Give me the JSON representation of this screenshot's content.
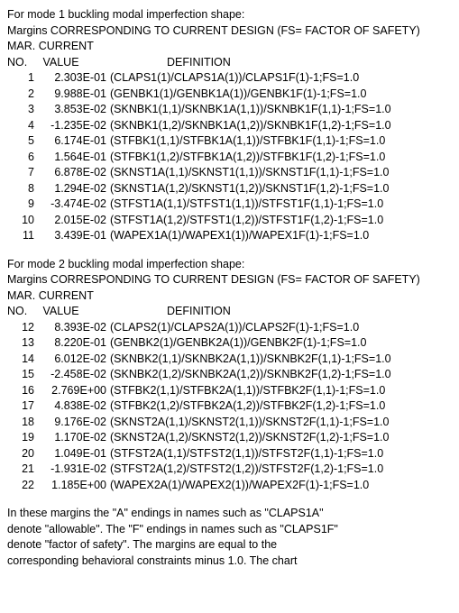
{
  "mode1": {
    "title": "For mode 1 buckling modal imperfection shape:",
    "subtitle": "Margins CORRESPONDING TO CURRENT DESIGN (FS= FACTOR OF SAFETY)",
    "header_mar": "MAR.",
    "header_cur": "CURRENT",
    "header_no": "NO.",
    "header_val": "VALUE",
    "header_def": "DEFINITION",
    "rows": [
      {
        "no": "1",
        "val": "2.303E-01",
        "def": "(CLAPS1(1)/CLAPS1A(1))/CLAPS1F(1)-1;FS=1.0"
      },
      {
        "no": "2",
        "val": "9.988E-01",
        "def": "(GENBK1(1)/GENBK1A(1))/GENBK1F(1)-1;FS=1.0"
      },
      {
        "no": "3",
        "val": "3.853E-02",
        "def": "(SKNBK1(1,1)/SKNBK1A(1,1))/SKNBK1F(1,1)-1;FS=1.0"
      },
      {
        "no": "4",
        "val": "-1.235E-02",
        "def": "(SKNBK1(1,2)/SKNBK1A(1,2))/SKNBK1F(1,2)-1;FS=1.0"
      },
      {
        "no": "5",
        "val": "6.174E-01",
        "def": "(STFBK1(1,1)/STFBK1A(1,1))/STFBK1F(1,1)-1;FS=1.0"
      },
      {
        "no": "6",
        "val": "1.564E-01",
        "def": "(STFBK1(1,2)/STFBK1A(1,2))/STFBK1F(1,2)-1;FS=1.0"
      },
      {
        "no": "7",
        "val": "6.878E-02",
        "def": "(SKNST1A(1,1)/SKNST1(1,1))/SKNST1F(1,1)-1;FS=1.0"
      },
      {
        "no": "8",
        "val": "1.294E-02",
        "def": "(SKNST1A(1,2)/SKNST1(1,2))/SKNST1F(1,2)-1;FS=1.0"
      },
      {
        "no": "9",
        "val": "-3.474E-02",
        "def": "(STFST1A(1,1)/STFST1(1,1))/STFST1F(1,1)-1;FS=1.0"
      },
      {
        "no": "10",
        "val": "2.015E-02",
        "def": "(STFST1A(1,2)/STFST1(1,2))/STFST1F(1,2)-1;FS=1.0"
      },
      {
        "no": "11",
        "val": "3.439E-01",
        "def": "(WAPEX1A(1)/WAPEX1(1))/WAPEX1F(1)-1;FS=1.0"
      }
    ]
  },
  "mode2": {
    "title": "For mode 2 buckling modal imperfection shape:",
    "subtitle": "Margins CORRESPONDING TO CURRENT DESIGN (FS= FACTOR OF SAFETY)",
    "header_mar": "MAR.",
    "header_cur": "CURRENT",
    "header_no": "NO.",
    "header_val": "VALUE",
    "header_def": "DEFINITION",
    "rows": [
      {
        "no": "12",
        "val": "8.393E-02",
        "def": "(CLAPS2(1)/CLAPS2A(1))/CLAPS2F(1)-1;FS=1.0"
      },
      {
        "no": "13",
        "val": "8.220E-01",
        "def": "(GENBK2(1)/GENBK2A(1))/GENBK2F(1)-1;FS=1.0"
      },
      {
        "no": "14",
        "val": "6.012E-02",
        "def": "(SKNBK2(1,1)/SKNBK2A(1,1))/SKNBK2F(1,1)-1;FS=1.0"
      },
      {
        "no": "15",
        "val": "-2.458E-02",
        "def": "(SKNBK2(1,2)/SKNBK2A(1,2))/SKNBK2F(1,2)-1;FS=1.0"
      },
      {
        "no": "16",
        "val": "2.769E+00",
        "def": "(STFBK2(1,1)/STFBK2A(1,1))/STFBK2F(1,1)-1;FS=1.0"
      },
      {
        "no": "17",
        "val": "4.838E-02",
        "def": "(STFBK2(1,2)/STFBK2A(1,2))/STFBK2F(1,2)-1;FS=1.0"
      },
      {
        "no": "18",
        "val": "9.176E-02",
        "def": "(SKNST2A(1,1)/SKNST2(1,1))/SKNST2F(1,1)-1;FS=1.0"
      },
      {
        "no": "19",
        "val": "1.170E-02",
        "def": "(SKNST2A(1,2)/SKNST2(1,2))/SKNST2F(1,2)-1;FS=1.0"
      },
      {
        "no": "20",
        "val": "1.049E-01",
        "def": "(STFST2A(1,1)/STFST2(1,1))/STFST2F(1,1)-1;FS=1.0"
      },
      {
        "no": "21",
        "val": "-1.931E-02",
        "def": "(STFST2A(1,2)/STFST2(1,2))/STFST2F(1,2)-1;FS=1.0"
      },
      {
        "no": "22",
        "val": "1.185E+00",
        "def": "(WAPEX2A(1)/WAPEX2(1))/WAPEX2F(1)-1;FS=1.0"
      }
    ]
  },
  "trailing": {
    "l1": "In these margins the \"A\" endings in names such as \"CLAPS1A\"",
    "l2": "denote \"allowable\". The \"F\" endings in names such as \"CLAPS1F\"",
    "l3": "denote \"factor of safety\". The margins are equal to the",
    "l4": "corresponding behavioral constraints minus 1.0. The chart"
  }
}
